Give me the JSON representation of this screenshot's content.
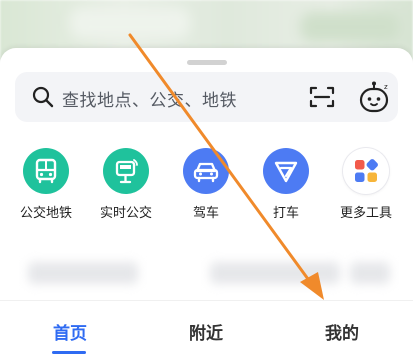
{
  "search": {
    "placeholder": "查找地点、公交、地铁"
  },
  "tools": [
    {
      "label": "公交地铁",
      "icon": "bus-icon",
      "color": "#1fc29c"
    },
    {
      "label": "实时公交",
      "icon": "realtime-bus-icon",
      "color": "#1fc29c"
    },
    {
      "label": "驾车",
      "icon": "car-icon",
      "color": "#4d7bf3"
    },
    {
      "label": "打车",
      "icon": "taxi-icon",
      "color": "#4d7bf3"
    },
    {
      "label": "更多工具",
      "icon": "more-tools-icon",
      "color": "#ffffff"
    }
  ],
  "tabs": [
    {
      "label": "首页",
      "active": true
    },
    {
      "label": "附近",
      "active": false
    },
    {
      "label": "我的",
      "active": false
    }
  ],
  "colors": {
    "accent": "#2f6bf2",
    "green": "#1fc29c",
    "blue": "#4d7bf3",
    "arrow": "#f08a2b"
  }
}
